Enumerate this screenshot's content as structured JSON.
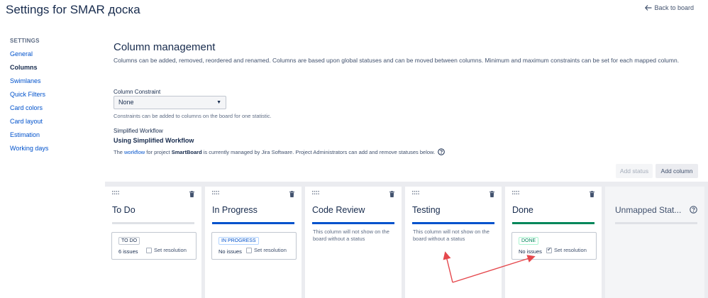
{
  "page": {
    "title": "Settings for SMAR доска",
    "back_label": "Back to board"
  },
  "sidebar": {
    "heading": "SETTINGS",
    "items": [
      {
        "label": "General"
      },
      {
        "label": "Columns"
      },
      {
        "label": "Swimlanes"
      },
      {
        "label": "Quick Filters"
      },
      {
        "label": "Card colors"
      },
      {
        "label": "Card layout"
      },
      {
        "label": "Estimation"
      },
      {
        "label": "Working days"
      }
    ],
    "active": "Columns"
  },
  "main": {
    "title": "Column management",
    "description": "Columns can be added, removed, reordered and renamed. Columns are based upon global statuses and can be moved between columns. Minimum and maximum constraints can be set for each mapped column.",
    "constraint_label": "Column Constraint",
    "constraint_value": "None",
    "constraint_help": "Constraints can be added to columns on the board for one statistic.",
    "workflow_label": "Simplified Workflow",
    "workflow_title": "Using Simplified Workflow",
    "workflow_desc_1": "The ",
    "workflow_link": "workflow",
    "workflow_desc_2": " for project ",
    "workflow_project": "SmartBoard",
    "workflow_desc_3": " is currently managed by Jira Software. Project Administrators can add and remove statuses below.",
    "add_status_label": "Add status",
    "add_column_label": "Add column"
  },
  "columns": [
    {
      "title": "To Do",
      "bar": "grey",
      "status": "TO DO",
      "issues": "6 issues",
      "resolution_label": "Set resolution",
      "resolution_checked": false
    },
    {
      "title": "In Progress",
      "bar": "blue",
      "status": "IN PROGRESS",
      "issues": "No issues",
      "resolution_label": "Set resolution",
      "resolution_checked": false
    },
    {
      "title": "Code Review",
      "bar": "blue",
      "note": "This column will not show on the board without a status"
    },
    {
      "title": "Testing",
      "bar": "blue",
      "note": "This column will not show on the board without a status"
    },
    {
      "title": "Done",
      "bar": "green",
      "status": "DONE",
      "issues": "No issues",
      "resolution_label": "Set resolution",
      "resolution_checked": true
    }
  ],
  "unmapped": {
    "title": "Unmapped Stat..."
  },
  "colors": {
    "link": "#0052cc",
    "blue_bar": "#0052cc",
    "green_bar": "#00875a",
    "annotation_arrow": "#e5484d"
  },
  "icons": {
    "back": "arrow-left-icon",
    "drag": "drag-handle-icon",
    "delete": "trash-icon",
    "help": "question-circle-icon",
    "dropdown": "caret-down-icon"
  }
}
